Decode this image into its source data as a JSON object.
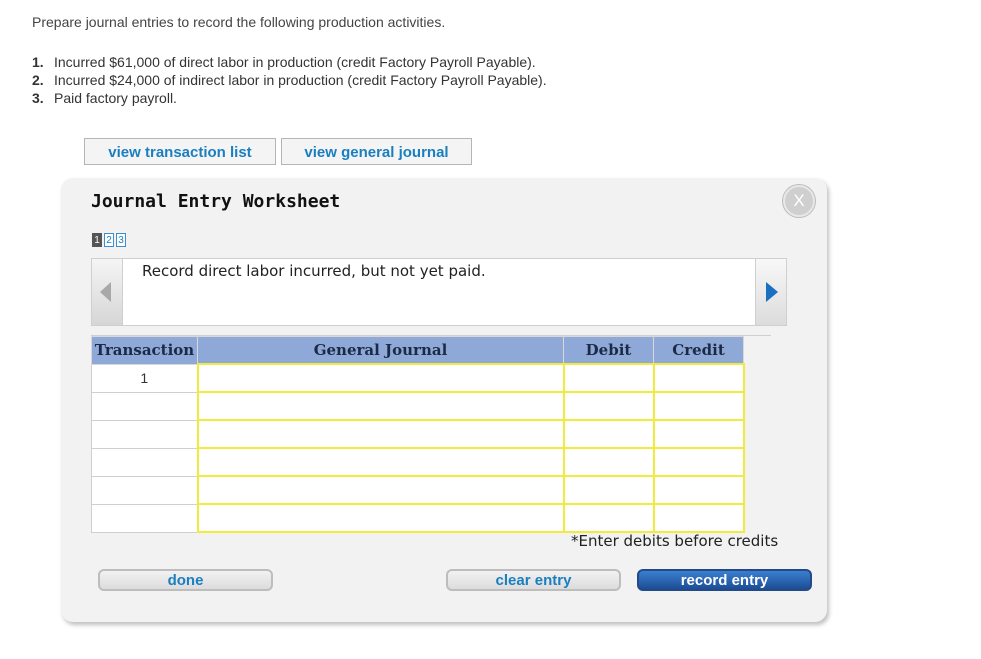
{
  "instructions": {
    "intro": "Prepare journal entries to record the following production activities.",
    "steps": [
      {
        "num": "1.",
        "text": "Incurred $61,000 of direct labor in production (credit Factory Payroll Payable)."
      },
      {
        "num": "2.",
        "text": "Incurred $24,000 of indirect labor in production (credit Factory Payroll Payable)."
      },
      {
        "num": "3.",
        "text": "Paid factory payroll."
      }
    ]
  },
  "toolbar": {
    "view_transaction_list": "view transaction list",
    "view_general_journal": "view general journal"
  },
  "worksheet": {
    "title": "Journal Entry Worksheet",
    "close_label": "X",
    "pages": [
      "1",
      "2",
      "3"
    ],
    "active_page": "1",
    "description": "Record direct labor incurred, but not yet paid.",
    "table": {
      "headers": {
        "transaction": "Transaction",
        "general_journal": "General Journal",
        "debit": "Debit",
        "credit": "Credit"
      },
      "rows": [
        {
          "transaction": "1",
          "account": "",
          "debit": "",
          "credit": ""
        },
        {
          "transaction": "",
          "account": "",
          "debit": "",
          "credit": ""
        },
        {
          "transaction": "",
          "account": "",
          "debit": "",
          "credit": ""
        },
        {
          "transaction": "",
          "account": "",
          "debit": "",
          "credit": ""
        },
        {
          "transaction": "",
          "account": "",
          "debit": "",
          "credit": ""
        },
        {
          "transaction": "",
          "account": "",
          "debit": "",
          "credit": ""
        }
      ]
    },
    "note": "*Enter debits before credits",
    "buttons": {
      "done": "done",
      "clear_entry": "clear entry",
      "record_entry": "record entry"
    }
  },
  "colors": {
    "link": "#1a7fc1",
    "header_bg": "#8ea9d8",
    "input_border": "#f0eb3c",
    "primary_button": "#1d4d96"
  }
}
